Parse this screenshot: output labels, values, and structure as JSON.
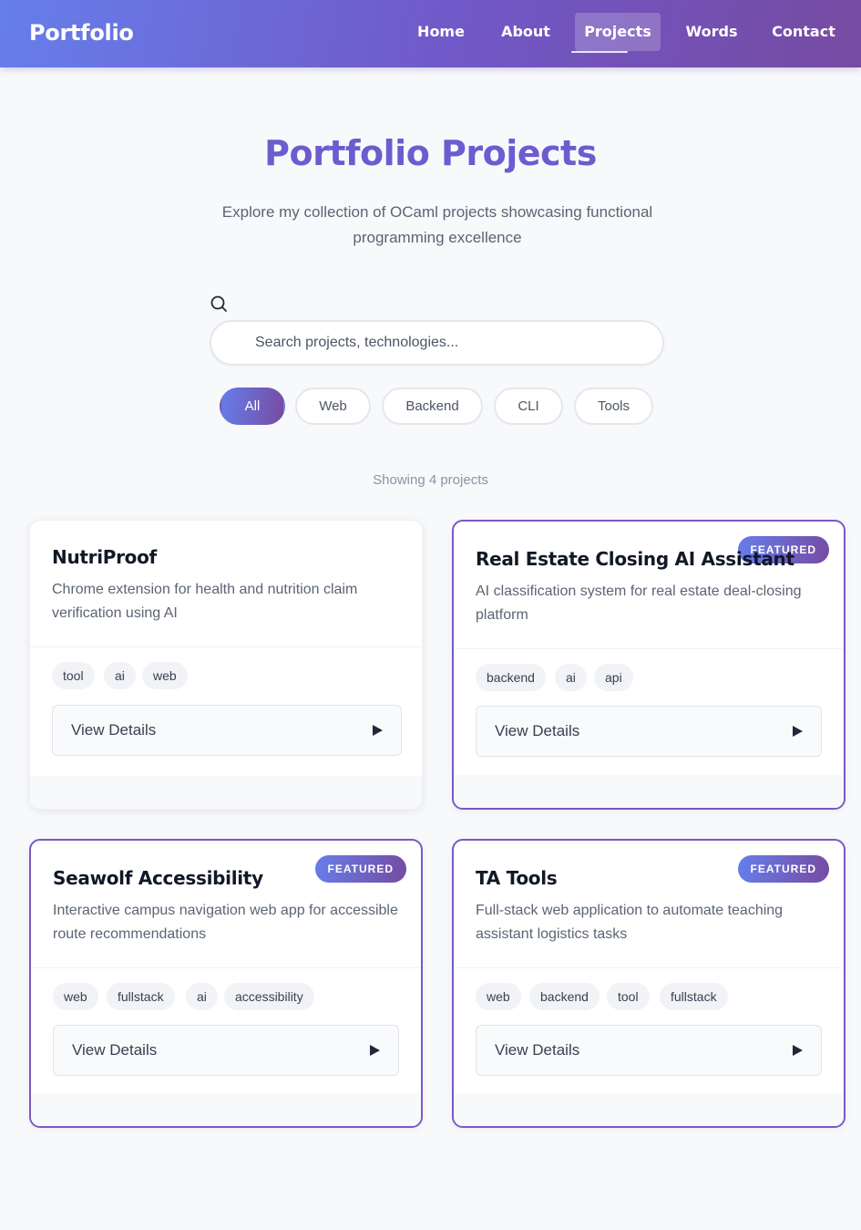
{
  "nav": {
    "brand": "Portfolio",
    "items": [
      {
        "label": "Home"
      },
      {
        "label": "About"
      },
      {
        "label": "Projects"
      },
      {
        "label": "Words"
      },
      {
        "label": "Contact"
      }
    ],
    "active": "Projects"
  },
  "hero": {
    "title": "Portfolio Projects",
    "subtitle": "Explore my collection of OCaml projects showcasing functional programming excellence"
  },
  "search": {
    "icon": "search-icon",
    "placeholder": "Search projects, technologies...",
    "value": ""
  },
  "filters": [
    {
      "label": "All",
      "active": true
    },
    {
      "label": "Web"
    },
    {
      "label": "Backend"
    },
    {
      "label": "CLI"
    },
    {
      "label": "Tools"
    }
  ],
  "results": {
    "label": "Showing 4 projects"
  },
  "projects": [
    {
      "title": "NutriProof",
      "description": "Chrome extension for health and nutrition claim verification using AI",
      "tags": [
        "tool",
        "ai",
        "web"
      ],
      "featured": false,
      "action": "View Details"
    },
    {
      "title": "Real Estate Closing AI Assistant",
      "description": "AI classification system for real estate deal-closing platform",
      "tags": [
        "backend",
        "ai",
        "api"
      ],
      "featured": true,
      "badge": "FEATURED",
      "action": "View Details"
    },
    {
      "title": "Seawolf Accessibility",
      "description": "Interactive campus navigation web app for accessible route recommendations",
      "tags": [
        "web",
        "fullstack",
        "ai",
        "accessibility"
      ],
      "featured": true,
      "badge": "FEATURED",
      "action": "View Details"
    },
    {
      "title": "TA Tools",
      "description": "Full-stack web application to automate teaching assistant logistics tasks",
      "tags": [
        "web",
        "backend",
        "tool",
        "fullstack"
      ],
      "featured": true,
      "badge": "FEATURED",
      "action": "View Details"
    }
  ],
  "colors": {
    "accent_start": "#667eea",
    "accent_end": "#764ba2",
    "title": "#6c5ccf"
  }
}
